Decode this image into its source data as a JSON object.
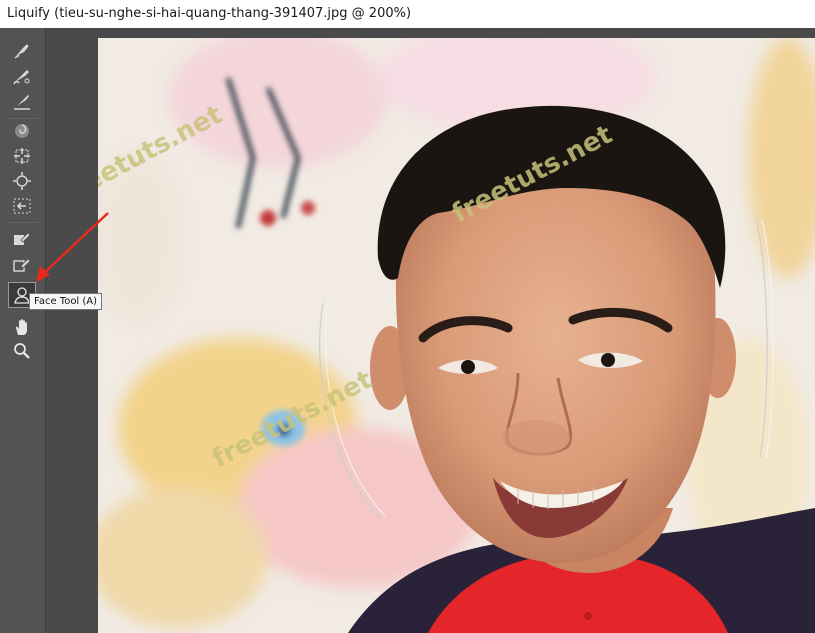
{
  "window": {
    "title": "Liquify (tieu-su-nghe-si-hai-quang-thang-391407.jpg @ 200%)"
  },
  "toolbar": {
    "tools": [
      {
        "icon": "forward-warp-icon"
      },
      {
        "icon": "reconstruct-icon"
      },
      {
        "icon": "smooth-icon"
      },
      {
        "icon": "twirl-clockwise-icon"
      },
      {
        "icon": "pucker-icon"
      },
      {
        "icon": "bloat-icon"
      },
      {
        "icon": "push-left-icon"
      },
      {
        "icon": "freeze-mask-icon"
      },
      {
        "icon": "thaw-mask-icon"
      },
      {
        "icon": "face-tool-icon",
        "active": true
      },
      {
        "icon": "hand-icon"
      },
      {
        "icon": "zoom-icon"
      }
    ],
    "tooltip": "Face Tool (A)"
  },
  "canvas": {
    "watermark": "freetuts.net"
  },
  "colors": {
    "panel": "#535353",
    "canvas_border": "#4a4a4a",
    "annotation_arrow": "#e8291c",
    "watermark": "#c8c27a"
  }
}
